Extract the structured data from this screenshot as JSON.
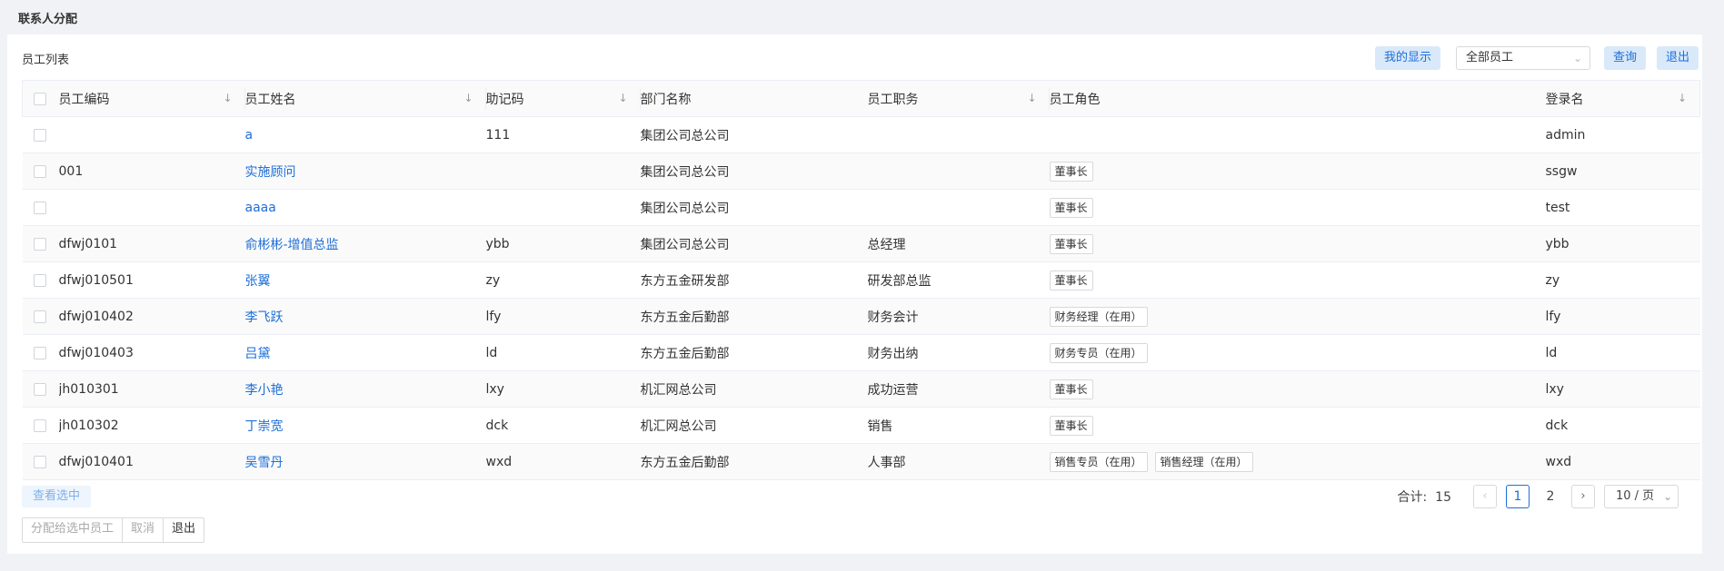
{
  "page": {
    "title": "联系人分配"
  },
  "toolbar": {
    "list_title": "员工列表",
    "my_display": "我的显示",
    "filter_value": "全部员工",
    "query": "查询",
    "exit": "退出"
  },
  "columns": {
    "code": "员工编码",
    "name": "员工姓名",
    "mnemonic": "助记码",
    "dept": "部门名称",
    "position": "员工职务",
    "role": "员工角色",
    "login": "登录名"
  },
  "rows": [
    {
      "code": "",
      "name": "a",
      "mnemonic": "111",
      "dept": "集团公司总公司",
      "position": "",
      "roles": [],
      "login": "admin"
    },
    {
      "code": "001",
      "name": "实施顾问",
      "mnemonic": "",
      "dept": "集团公司总公司",
      "position": "",
      "roles": [
        "董事长"
      ],
      "login": "ssgw"
    },
    {
      "code": "",
      "name": "aaaa",
      "mnemonic": "",
      "dept": "集团公司总公司",
      "position": "",
      "roles": [
        "董事长"
      ],
      "login": "test"
    },
    {
      "code": "dfwj0101",
      "name": "俞彬彬-增值总监",
      "mnemonic": "ybb",
      "dept": "集团公司总公司",
      "position": "总经理",
      "roles": [
        "董事长"
      ],
      "login": "ybb"
    },
    {
      "code": "dfwj010501",
      "name": "张翼",
      "mnemonic": "zy",
      "dept": "东方五金研发部",
      "position": "研发部总监",
      "roles": [
        "董事长"
      ],
      "login": "zy"
    },
    {
      "code": "dfwj010402",
      "name": "李飞跃",
      "mnemonic": "lfy",
      "dept": "东方五金后勤部",
      "position": "财务会计",
      "roles": [
        "财务经理（在用）"
      ],
      "login": "lfy"
    },
    {
      "code": "dfwj010403",
      "name": "吕黛",
      "mnemonic": "ld",
      "dept": "东方五金后勤部",
      "position": "财务出纳",
      "roles": [
        "财务专员（在用）"
      ],
      "login": "ld"
    },
    {
      "code": "jh010301",
      "name": "李小艳",
      "mnemonic": "lxy",
      "dept": "机汇网总公司",
      "position": "成功运营",
      "roles": [
        "董事长"
      ],
      "login": "lxy"
    },
    {
      "code": "jh010302",
      "name": "丁崇宽",
      "mnemonic": "dck",
      "dept": "机汇网总公司",
      "position": "销售",
      "roles": [
        "董事长"
      ],
      "login": "dck"
    },
    {
      "code": "dfwj010401",
      "name": "吴雪丹",
      "mnemonic": "wxd",
      "dept": "东方五金后勤部",
      "position": "人事部",
      "roles": [
        "销售专员（在用）",
        "销售经理（在用）"
      ],
      "login": "wxd"
    }
  ],
  "footer": {
    "check_selected": "查看选中",
    "assign": "分配给选中员工",
    "cancel": "取消",
    "exit": "退出"
  },
  "pagination": {
    "total_label": "合计:",
    "total": "15",
    "pages": [
      "1",
      "2"
    ],
    "current_page": "1",
    "page_size": "10 / 页"
  },
  "icons": {
    "sort": "sort-down-arrow-icon",
    "chevron_down": "chevron-down-icon",
    "prev": "chevron-left-icon",
    "next": "chevron-right-icon"
  },
  "colors": {
    "accent": "#1e6fd9",
    "button_bg": "#d9e9fa"
  }
}
